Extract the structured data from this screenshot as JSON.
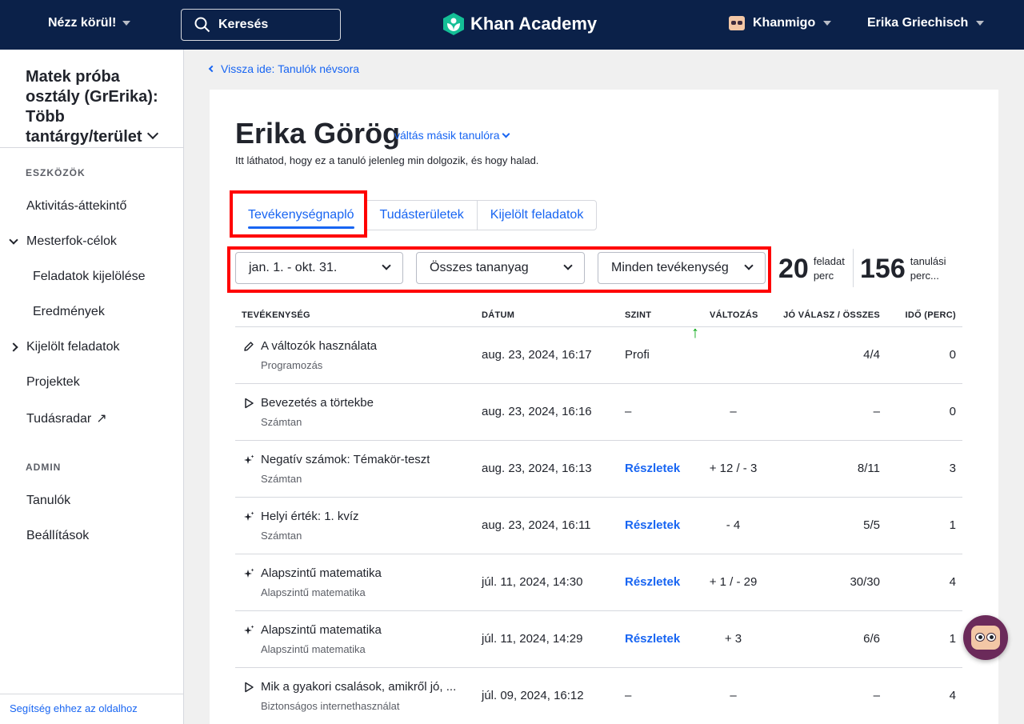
{
  "topbar": {
    "explore_label": "Nézz körül!",
    "search_placeholder": "Keresés",
    "logo_text": "Khan Academy",
    "khanmigo_label": "Khanmigo",
    "user_name": "Erika Griechisch"
  },
  "sidebar": {
    "class_title": "Matek próba osztály (GrErika): Több tantárgy/terület",
    "tools_heading": "ESZKÖZÖK",
    "items": [
      {
        "label": "Aktivitás-áttekintő"
      },
      {
        "label": "Mesterfok-célok"
      },
      {
        "label": "Feladatok kijelölése"
      },
      {
        "label": "Eredmények"
      },
      {
        "label": "Kijelölt feladatok"
      },
      {
        "label": "Projektek"
      },
      {
        "label": "Tudásradar"
      }
    ],
    "admin_heading": "ADMIN",
    "admin_items": [
      {
        "label": "Tanulók"
      },
      {
        "label": "Beállítások"
      }
    ],
    "help_link": "Segítség ehhez az oldalhoz"
  },
  "main": {
    "back_link": "Vissza ide: Tanulók névsora",
    "student_name": "Erika Görög",
    "switch_link": "váltás másik tanulóra",
    "subtitle": "Itt láthatod, hogy ez a tanuló jelenleg min dolgozik, és hogy halad.",
    "tabs": [
      {
        "label": "Tevékenységnapló",
        "active": true
      },
      {
        "label": "Tudásterületek",
        "active": false
      },
      {
        "label": "Kijelölt feladatok",
        "active": false
      }
    ],
    "filters": {
      "date": "jan. 1. - okt. 31.",
      "content": "Összes tananyag",
      "activity": "Minden tevékenység"
    },
    "stats": {
      "tasks_num": "20",
      "tasks_label_1": "feladat",
      "tasks_label_2": "perc",
      "learning_num": "156",
      "learning_label_1": "tanulási",
      "learning_label_2": "perc..."
    },
    "table": {
      "headers": {
        "activity": "TEVÉKENYSÉG",
        "date": "DÁTUM",
        "level": "SZINT",
        "change": "VÁLTOZÁS",
        "correct": "JÓ VÁLASZ / ÖSSZES",
        "time": "IDŐ (PERC)"
      },
      "rows": [
        {
          "icon": "pencil-icon",
          "title": "A változók használata",
          "subject": "Programozás",
          "date": "aug. 23, 2024, 16:17",
          "level": "Profi",
          "change": "↑",
          "correct": "4/4",
          "time": "0"
        },
        {
          "icon": "play-icon",
          "title": "Bevezetés a törtekbe",
          "subject": "Számtan",
          "date": "aug. 23, 2024, 16:16",
          "level": "–",
          "change": "–",
          "correct": "–",
          "time": "0"
        },
        {
          "icon": "sparkle-icon",
          "title": "Negatív számok: Témakör-teszt",
          "subject": "Számtan",
          "date": "aug. 23, 2024, 16:13",
          "level": "Részletek",
          "change": "+ 12 / - 3",
          "correct": "8/11",
          "time": "3"
        },
        {
          "icon": "sparkle-icon",
          "title": "Helyi érték: 1. kvíz",
          "subject": "Számtan",
          "date": "aug. 23, 2024, 16:11",
          "level": "Részletek",
          "change": "- 4",
          "correct": "5/5",
          "time": "1"
        },
        {
          "icon": "sparkle-icon",
          "title": "Alapszintű matematika",
          "subject": "Alapszintű matematika",
          "date": "júl. 11, 2024, 14:30",
          "level": "Részletek",
          "change": "+ 1 / - 29",
          "correct": "30/30",
          "time": "4"
        },
        {
          "icon": "sparkle-icon",
          "title": "Alapszintű matematika",
          "subject": "Alapszintű matematika",
          "date": "júl. 11, 2024, 14:29",
          "level": "Részletek",
          "change": "+ 3",
          "correct": "6/6",
          "time": "1"
        },
        {
          "icon": "play-icon",
          "title": "Mik a gyakori csalások, amikről jó, ...",
          "subject": "Biztonságos internethasználat",
          "date": "júl. 09, 2024, 16:12",
          "level": "–",
          "change": "–",
          "correct": "–",
          "time": "4"
        }
      ]
    }
  },
  "colors": {
    "nav_bg": "#0b2149",
    "link_blue": "#1865f2",
    "highlight_red": "#ff0000",
    "up_green": "#00a60e"
  }
}
